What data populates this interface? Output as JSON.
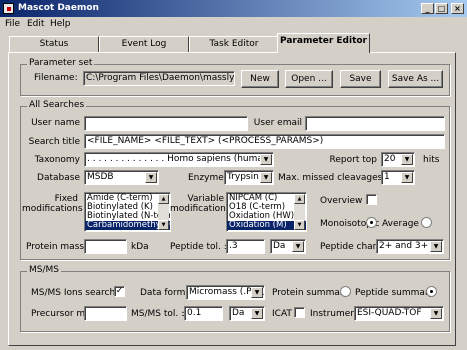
{
  "window": {
    "title": "Mascot Daemon",
    "minimize": "_",
    "maximize": "□",
    "close": "×"
  },
  "menu": [
    "File",
    "Edit",
    "Help"
  ],
  "tabs": [
    "Status",
    "Event Log",
    "Task Editor",
    "Parameter Editor"
  ],
  "parameter_set": {
    "title": "Parameter set",
    "filename_label": "Filename:",
    "filename": "C:\\Program Files\\Daemon\\masslynx.par",
    "buttons": {
      "new": "New",
      "open": "Open ...",
      "save": "Save",
      "save_as": "Save As ..."
    }
  },
  "all_searches": {
    "title": "All Searches",
    "user_name_label": "User name",
    "user_name": "",
    "user_email_label": "User email",
    "user_email": "",
    "search_title_label": "Search title",
    "search_title": "<FILE_NAME> <FILE_TEXT> (<PROCESS_PARAMS>)",
    "taxonomy_label": "Taxonomy",
    "taxonomy": ". . . . . . . . . . . . . . Homo sapiens (human)",
    "report_top_label": "Report top",
    "report_top": "20",
    "hits_label": "hits",
    "database_label": "Database",
    "database": "MSDB",
    "enzyme_label": "Enzyme",
    "enzyme": "Trypsin",
    "missed_label": "Max. missed cleavages",
    "missed": "1",
    "fixed_label": [
      "Fixed",
      "modifications"
    ],
    "fixed_mods": [
      "Amide (C-term)",
      "Biotinylated (K)",
      "Biotinylated (N-term",
      "Carbamidomethyl (C"
    ],
    "fixed_selected": 3,
    "variable_label": [
      "Variable",
      "modifications"
    ],
    "variable_mods": [
      "NIPCAM (C)",
      "O18 (C-term)",
      "Oxidation (HW)",
      "Oxidation (M)"
    ],
    "variable_selected": 3,
    "overview_label": "Overview",
    "monoisotopic_label": "Monoisotopic",
    "average_label": "Average",
    "protein_mass_label": "Protein mass",
    "protein_mass": "",
    "kda_label": "kDa",
    "peptide_tol_label": "Peptide tol. ±",
    "peptide_tol": ".3",
    "peptide_tol_unit": "Da",
    "peptide_charge_label": "Peptide charge",
    "peptide_charge": "2+ and 3+"
  },
  "msms": {
    "title": "MS/MS",
    "ions_label": "MS/MS Ions search",
    "ions_checked": "✓",
    "data_format_label": "Data format",
    "data_format": "Micromass (.PKL)",
    "protein_summary_label": "Protein summary",
    "peptide_summary_label": "Peptide summary",
    "precursor_label": "Precursor m/z",
    "precursor": "",
    "msms_tol_label": "MS/MS tol. ±",
    "msms_tol": "0.1",
    "msms_tol_unit": "Da",
    "icat_label": "ICAT",
    "instrument_label": "Instrument",
    "instrument": "ESI-QUAD-TOF"
  }
}
